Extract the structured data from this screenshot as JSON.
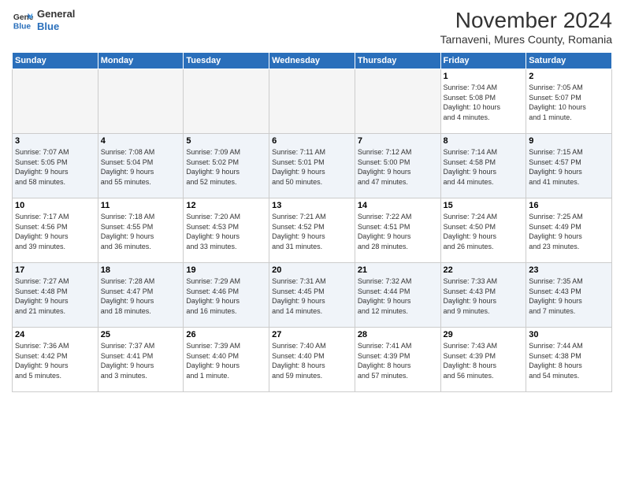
{
  "header": {
    "logo_line1": "General",
    "logo_line2": "Blue",
    "month_title": "November 2024",
    "location": "Tarnaveni, Mures County, Romania"
  },
  "weekdays": [
    "Sunday",
    "Monday",
    "Tuesday",
    "Wednesday",
    "Thursday",
    "Friday",
    "Saturday"
  ],
  "weeks": [
    {
      "alt": false,
      "days": [
        {
          "num": "",
          "info": "",
          "empty": true
        },
        {
          "num": "",
          "info": "",
          "empty": true
        },
        {
          "num": "",
          "info": "",
          "empty": true
        },
        {
          "num": "",
          "info": "",
          "empty": true
        },
        {
          "num": "",
          "info": "",
          "empty": true
        },
        {
          "num": "1",
          "info": "Sunrise: 7:04 AM\nSunset: 5:08 PM\nDaylight: 10 hours\nand 4 minutes."
        },
        {
          "num": "2",
          "info": "Sunrise: 7:05 AM\nSunset: 5:07 PM\nDaylight: 10 hours\nand 1 minute."
        }
      ]
    },
    {
      "alt": true,
      "days": [
        {
          "num": "3",
          "info": "Sunrise: 7:07 AM\nSunset: 5:05 PM\nDaylight: 9 hours\nand 58 minutes."
        },
        {
          "num": "4",
          "info": "Sunrise: 7:08 AM\nSunset: 5:04 PM\nDaylight: 9 hours\nand 55 minutes."
        },
        {
          "num": "5",
          "info": "Sunrise: 7:09 AM\nSunset: 5:02 PM\nDaylight: 9 hours\nand 52 minutes."
        },
        {
          "num": "6",
          "info": "Sunrise: 7:11 AM\nSunset: 5:01 PM\nDaylight: 9 hours\nand 50 minutes."
        },
        {
          "num": "7",
          "info": "Sunrise: 7:12 AM\nSunset: 5:00 PM\nDaylight: 9 hours\nand 47 minutes."
        },
        {
          "num": "8",
          "info": "Sunrise: 7:14 AM\nSunset: 4:58 PM\nDaylight: 9 hours\nand 44 minutes."
        },
        {
          "num": "9",
          "info": "Sunrise: 7:15 AM\nSunset: 4:57 PM\nDaylight: 9 hours\nand 41 minutes."
        }
      ]
    },
    {
      "alt": false,
      "days": [
        {
          "num": "10",
          "info": "Sunrise: 7:17 AM\nSunset: 4:56 PM\nDaylight: 9 hours\nand 39 minutes."
        },
        {
          "num": "11",
          "info": "Sunrise: 7:18 AM\nSunset: 4:55 PM\nDaylight: 9 hours\nand 36 minutes."
        },
        {
          "num": "12",
          "info": "Sunrise: 7:20 AM\nSunset: 4:53 PM\nDaylight: 9 hours\nand 33 minutes."
        },
        {
          "num": "13",
          "info": "Sunrise: 7:21 AM\nSunset: 4:52 PM\nDaylight: 9 hours\nand 31 minutes."
        },
        {
          "num": "14",
          "info": "Sunrise: 7:22 AM\nSunset: 4:51 PM\nDaylight: 9 hours\nand 28 minutes."
        },
        {
          "num": "15",
          "info": "Sunrise: 7:24 AM\nSunset: 4:50 PM\nDaylight: 9 hours\nand 26 minutes."
        },
        {
          "num": "16",
          "info": "Sunrise: 7:25 AM\nSunset: 4:49 PM\nDaylight: 9 hours\nand 23 minutes."
        }
      ]
    },
    {
      "alt": true,
      "days": [
        {
          "num": "17",
          "info": "Sunrise: 7:27 AM\nSunset: 4:48 PM\nDaylight: 9 hours\nand 21 minutes."
        },
        {
          "num": "18",
          "info": "Sunrise: 7:28 AM\nSunset: 4:47 PM\nDaylight: 9 hours\nand 18 minutes."
        },
        {
          "num": "19",
          "info": "Sunrise: 7:29 AM\nSunset: 4:46 PM\nDaylight: 9 hours\nand 16 minutes."
        },
        {
          "num": "20",
          "info": "Sunrise: 7:31 AM\nSunset: 4:45 PM\nDaylight: 9 hours\nand 14 minutes."
        },
        {
          "num": "21",
          "info": "Sunrise: 7:32 AM\nSunset: 4:44 PM\nDaylight: 9 hours\nand 12 minutes."
        },
        {
          "num": "22",
          "info": "Sunrise: 7:33 AM\nSunset: 4:43 PM\nDaylight: 9 hours\nand 9 minutes."
        },
        {
          "num": "23",
          "info": "Sunrise: 7:35 AM\nSunset: 4:43 PM\nDaylight: 9 hours\nand 7 minutes."
        }
      ]
    },
    {
      "alt": false,
      "days": [
        {
          "num": "24",
          "info": "Sunrise: 7:36 AM\nSunset: 4:42 PM\nDaylight: 9 hours\nand 5 minutes."
        },
        {
          "num": "25",
          "info": "Sunrise: 7:37 AM\nSunset: 4:41 PM\nDaylight: 9 hours\nand 3 minutes."
        },
        {
          "num": "26",
          "info": "Sunrise: 7:39 AM\nSunset: 4:40 PM\nDaylight: 9 hours\nand 1 minute."
        },
        {
          "num": "27",
          "info": "Sunrise: 7:40 AM\nSunset: 4:40 PM\nDaylight: 8 hours\nand 59 minutes."
        },
        {
          "num": "28",
          "info": "Sunrise: 7:41 AM\nSunset: 4:39 PM\nDaylight: 8 hours\nand 57 minutes."
        },
        {
          "num": "29",
          "info": "Sunrise: 7:43 AM\nSunset: 4:39 PM\nDaylight: 8 hours\nand 56 minutes."
        },
        {
          "num": "30",
          "info": "Sunrise: 7:44 AM\nSunset: 4:38 PM\nDaylight: 8 hours\nand 54 minutes."
        }
      ]
    }
  ]
}
